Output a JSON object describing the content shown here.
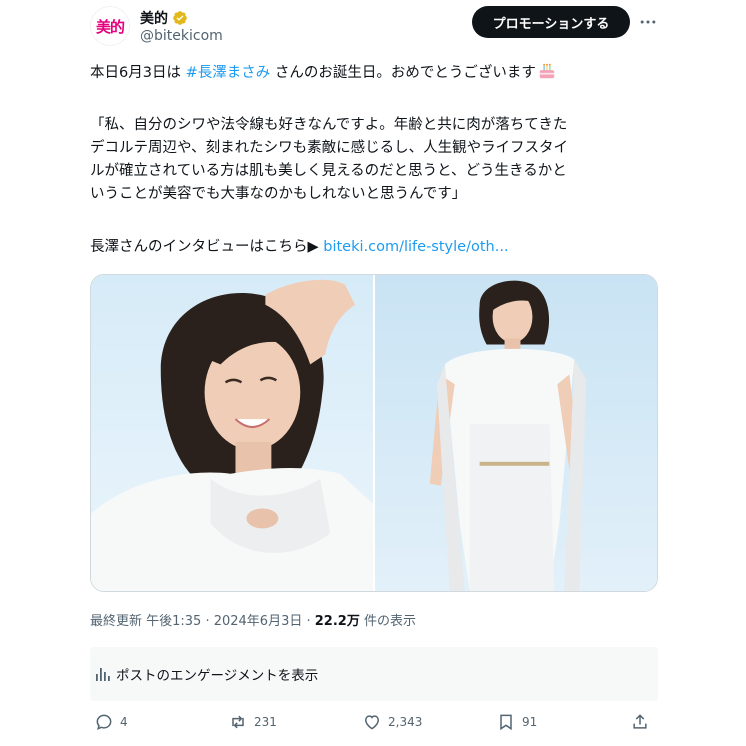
{
  "account": {
    "avatar_text": "美的",
    "display_name": "美的",
    "handle": "@bitekicom",
    "verified_icon": "gold-verified-badge-icon"
  },
  "header": {
    "promote_label": "プロモーションする",
    "more_icon": "more-horizontal-icon"
  },
  "post": {
    "line1_prefix": "本日6月3日は ",
    "hashtag": "#長澤まさみ",
    "line1_suffix": " さんのお誕生日。おめでとうございます",
    "cake_icon": "birthday-cake-emoji",
    "quote_lines": [
      "「私、自分のシワや法令線も好きなんですよ。年齢と共に肉が落ちてきた",
      "デコルテ周辺や、刻まれたシワも素敵に感じるし、人生観やライフスタイ",
      "ルが確立されている方は肌も美しく見えるのだと思うと、どう生きるかと",
      "いうことが美容でも大事なのかもしれないと思うんです」"
    ],
    "interview_prefix": "長澤さんのインタビューはこちら▶ ",
    "interview_link": "biteki.com/life-style/oth..."
  },
  "media": {
    "photos": [
      "portrait-smiling",
      "full-length-white-outfit"
    ]
  },
  "meta": {
    "updated": "最終更新 午後1:35 · 2024年6月3日 · ",
    "views_count": "22.2万",
    "views_label": " 件の表示"
  },
  "engagement": {
    "label": "ポストのエンゲージメントを表示",
    "icon": "analytics-bar-icon"
  },
  "actions": {
    "replies": "4",
    "reposts": "231",
    "likes": "2,343",
    "bookmarks": "91"
  },
  "colors": {
    "link": "#1d9bf0",
    "text": "#0f1419",
    "secondary": "#536471",
    "brand": "#e6007e"
  }
}
